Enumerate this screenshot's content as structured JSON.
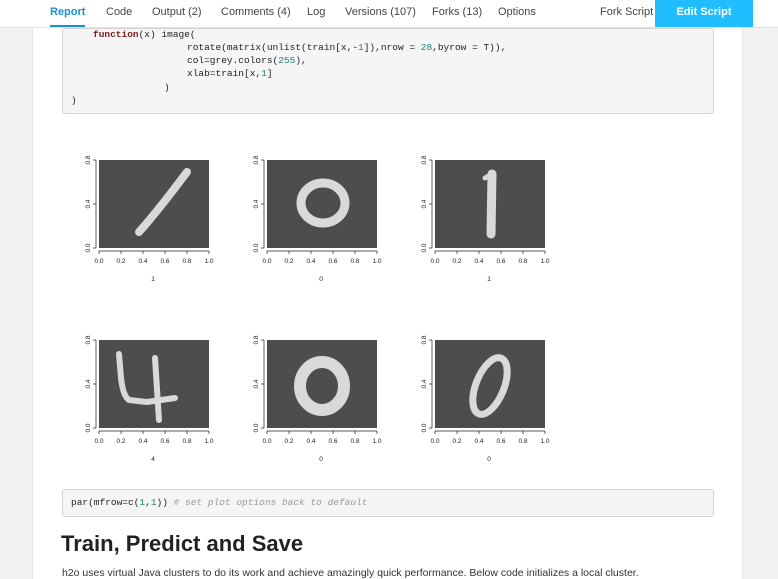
{
  "tabs": [
    {
      "label": "Report",
      "active": true
    },
    {
      "label": "Code",
      "active": false
    },
    {
      "label": "Output (2)",
      "active": false
    },
    {
      "label": "Comments (4)",
      "active": false
    },
    {
      "label": "Log",
      "active": false
    },
    {
      "label": "Versions (107)",
      "active": false
    },
    {
      "label": "Forks (13)",
      "active": false
    },
    {
      "label": "Options",
      "active": false
    }
  ],
  "fork_script_label": "Fork Script",
  "edit_script_label": "Edit Script",
  "code1": {
    "line1_kw": "function",
    "line1_rest": "(x) image(",
    "line2_a": "rotate(matrix(unlist(train[x,-",
    "line2_n1": "1",
    "line2_b": "]),nrow = ",
    "line2_n2": "28",
    "line2_c": ",byrow = T)),",
    "line3_a": "col=grey.colors(",
    "line3_n": "255",
    "line3_b": "),",
    "line4_a": "xlab=train[x,",
    "line4_n": "1",
    "line4_b": "]",
    "line5": ")",
    "line6": ")"
  },
  "plots": [
    {
      "digit": "1",
      "xlabel": "1"
    },
    {
      "digit": "0",
      "xlabel": "0"
    },
    {
      "digit": "1",
      "xlabel": "1"
    },
    {
      "digit": "4",
      "xlabel": "4"
    },
    {
      "digit": "0",
      "xlabel": "0"
    },
    {
      "digit": "0",
      "xlabel": "0"
    }
  ],
  "axis": {
    "x_ticks": [
      "0.0",
      "0.2",
      "0.4",
      "0.6",
      "0.8",
      "1.0"
    ],
    "y_ticks": [
      "0.0",
      "0.4",
      "0.8"
    ]
  },
  "code2": {
    "a": "par(mfrow=c(",
    "n1": "1",
    "b": ",",
    "n2": "1",
    "c": ")) ",
    "comment": "# set plot options back to default"
  },
  "heading": "Train, Predict and Save",
  "paragraph": "h2o uses virtual Java clusters to do its work and achieve amazingly quick performance. Below code initializes a local cluster.",
  "colors": {
    "accent": "#1a8fd8",
    "edit_button": "#20beff",
    "plot_bg": "#4d4d4d",
    "digit": "#d9d9d9"
  }
}
